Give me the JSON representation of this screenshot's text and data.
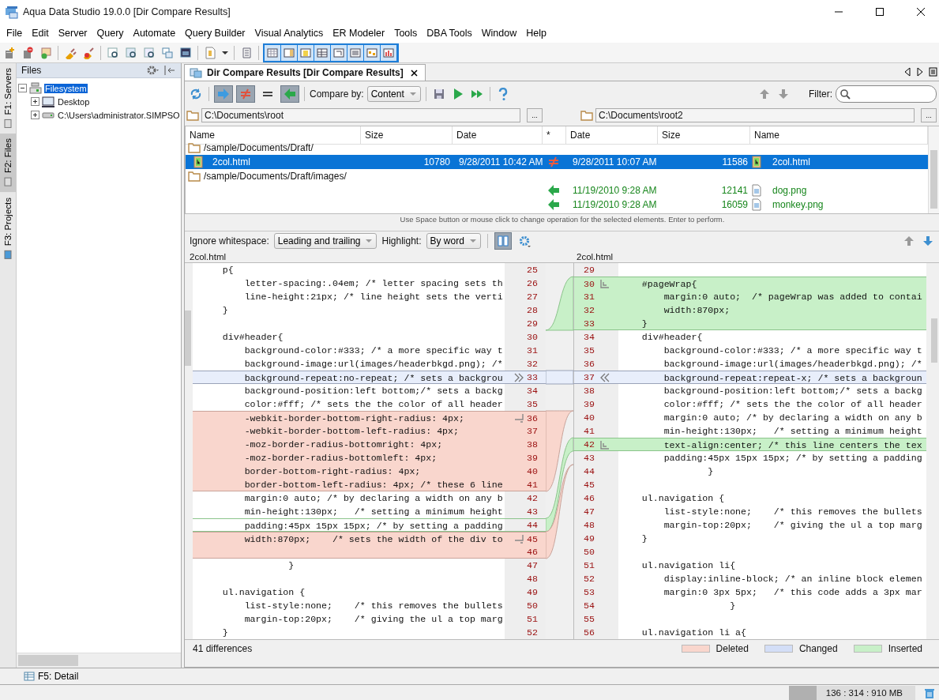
{
  "window": {
    "title": "Aqua Data Studio 19.0.0  [Dir Compare Results]"
  },
  "menu": [
    "File",
    "Edit",
    "Server",
    "Query",
    "Automate",
    "Query Builder",
    "Visual Analytics",
    "ER Modeler",
    "Tools",
    "DBA Tools",
    "Window",
    "Help"
  ],
  "side_tabs": [
    {
      "label": "F1: Servers",
      "selected": false
    },
    {
      "label": "F2: Files",
      "selected": true
    },
    {
      "label": "F3: Projects",
      "selected": false
    }
  ],
  "files_panel": {
    "title": "Files",
    "tree": [
      {
        "label": "Filesystem",
        "kind": "filesystem",
        "expanded": true,
        "selected": true,
        "children": [
          {
            "label": "Desktop",
            "kind": "desktop",
            "expanded": false,
            "selected": false
          },
          {
            "label": "C:\\Users\\administrator.SIMPSO",
            "kind": "drive",
            "expanded": false,
            "selected": false
          }
        ]
      }
    ]
  },
  "document_tab": {
    "title": "Dir Compare Results [Dir Compare Results]"
  },
  "compare_toolbar": {
    "toggles": [
      {
        "kind": "copy_right",
        "selected": true
      },
      {
        "kind": "different",
        "selected": true
      },
      {
        "kind": "equal",
        "selected": false
      },
      {
        "kind": "copy_left",
        "selected": true
      }
    ],
    "compare_by_label": "Compare by:",
    "compare_by": "Content",
    "filter_label": "Filter:"
  },
  "paths": [
    {
      "path": "C:\\Documents\\root",
      "browse": "..."
    },
    {
      "path": "C:\\Documents\\root2",
      "browse": "..."
    }
  ],
  "file_table": {
    "columns": [
      "Name",
      "Size",
      "Date",
      "*",
      "Date",
      "Size",
      "Name"
    ],
    "rows": [
      {
        "kind": "folder",
        "path": "/sample/Documents/Draft/",
        "selected": false
      },
      {
        "kind": "different",
        "selected": true,
        "left": {
          "kind": "html",
          "name": "2col.html",
          "size": "10780",
          "date": "9/28/2011 10:42 AM"
        },
        "right": {
          "kind": "html",
          "name": "2col.html",
          "size": "11586",
          "date": "9/28/2011 10:07 AM"
        }
      },
      {
        "kind": "folder",
        "path": "/sample/Documents/Draft/images/",
        "selected": false
      },
      {
        "kind": "right_only",
        "selected": false,
        "right": {
          "kind": "image",
          "name": "dog.png",
          "size": "12141",
          "date": "11/19/2010 9:28 AM"
        }
      },
      {
        "kind": "right_only",
        "selected": false,
        "right": {
          "kind": "image",
          "name": "monkey.png",
          "size": "16059",
          "date": "11/19/2010 9:28 AM"
        }
      }
    ],
    "hint": "Use Space button or mouse click to change operation for the selected elements. Enter to perform."
  },
  "diff_toolbar": {
    "ignore_label": "Ignore whitespace:",
    "ignore_value": "Leading and trailing",
    "highlight_label": "Highlight:",
    "highlight_value": "By word",
    "side_by_side": {
      "selected": true
    }
  },
  "diff": {
    "left": {
      "file": "2col.html",
      "lines": [
        {
          "num": "25",
          "text": "    p{",
          "kind": "normal"
        },
        {
          "num": "26",
          "text": "        letter-spacing:.04em; /* letter spacing sets th",
          "kind": "normal"
        },
        {
          "num": "27",
          "text": "        line-height:21px; /* line height sets the verti",
          "kind": "normal"
        },
        {
          "num": "28",
          "text": "    }",
          "kind": "normal"
        },
        {
          "num": "29",
          "kind": "normal"
        },
        {
          "num": "30",
          "text": "    div#header{",
          "kind": "normal"
        },
        {
          "num": "31",
          "text": "        background-color:#333; /* a more specific way t",
          "kind": "normal"
        },
        {
          "num": "32",
          "text": "        background-image:url(images/headerbkgd.png); /*",
          "kind": "normal"
        },
        {
          "num": "33",
          "text": "        background-repeat:no-repeat; /* sets a backgrou",
          "kind": "changed",
          "marker": true
        },
        {
          "num": "34",
          "text": "        background-position:left bottom;/* sets a backg",
          "kind": "normal"
        },
        {
          "num": "35",
          "text": "        color:#fff; /* sets the the color of all header",
          "kind": "normal"
        },
        {
          "num": "36",
          "text": "        -webkit-border-bottom-right-radius: 4px;",
          "kind": "deleted",
          "marker": true
        },
        {
          "num": "37",
          "text": "        -webkit-border-bottom-left-radius: 4px;",
          "kind": "deleted"
        },
        {
          "num": "38",
          "text": "        -moz-border-radius-bottomright: 4px;",
          "kind": "deleted"
        },
        {
          "num": "39",
          "text": "        -moz-border-radius-bottomleft: 4px;",
          "kind": "deleted"
        },
        {
          "num": "40",
          "text": "        border-bottom-right-radius: 4px;",
          "kind": "deleted"
        },
        {
          "num": "41",
          "text": "        border-bottom-left-radius: 4px; /* these 6 line",
          "kind": "deleted"
        },
        {
          "num": "42",
          "text": "        margin:0 auto; /* by declaring a width on any b",
          "kind": "normal"
        },
        {
          "num": "43",
          "text": "        min-height:130px;   /* setting a minimum height",
          "kind": "normal"
        },
        {
          "num": "44",
          "text": "        padding:45px 15px 15px; /* by setting a padding",
          "kind": "anchor"
        },
        {
          "num": "45",
          "text": "        width:870px;    /* sets the width of the div to",
          "kind": "deleted",
          "marker": true
        },
        {
          "num": "46",
          "kind": "deleted"
        },
        {
          "num": "47",
          "text": "                }",
          "kind": "normal"
        },
        {
          "num": "48",
          "kind": "normal"
        },
        {
          "num": "49",
          "text": "    ul.navigation {",
          "kind": "normal"
        },
        {
          "num": "50",
          "text": "        list-style:none;    /* this removes the bullets",
          "kind": "normal"
        },
        {
          "num": "51",
          "text": "        margin-top:20px;    /* giving the ul a top marg",
          "kind": "normal"
        },
        {
          "num": "52",
          "text": "    }",
          "kind": "normal"
        }
      ]
    },
    "right": {
      "file": "2col.html",
      "lines": [
        {
          "num": "29",
          "kind": "normal"
        },
        {
          "num": "30",
          "text": "    #pageWrap{",
          "kind": "inserted",
          "marker": true
        },
        {
          "num": "31",
          "text": "        margin:0 auto;  /* pageWrap was added to contai",
          "kind": "inserted"
        },
        {
          "num": "32",
          "text": "        width:870px;",
          "kind": "inserted"
        },
        {
          "num": "33",
          "text": "    }",
          "kind": "inserted"
        },
        {
          "num": "34",
          "text": "    div#header{",
          "kind": "normal"
        },
        {
          "num": "35",
          "text": "        background-color:#333; /* a more specific way t",
          "kind": "normal"
        },
        {
          "num": "36",
          "text": "        background-image:url(images/headerbkgd.png); /*",
          "kind": "normal"
        },
        {
          "num": "37",
          "text": "        background-repeat:repeat-x; /* sets a backgroun",
          "kind": "changed",
          "marker": true
        },
        {
          "num": "38",
          "text": "        background-position:left bottom;/* sets a backg",
          "kind": "normal"
        },
        {
          "num": "39",
          "text": "        color:#fff; /* sets the the color of all header",
          "kind": "normal"
        },
        {
          "num": "40",
          "text": "        margin:0 auto; /* by declaring a width on any b",
          "kind": "normal"
        },
        {
          "num": "41",
          "text": "        min-height:130px;   /* setting a minimum height",
          "kind": "normal"
        },
        {
          "num": "42",
          "text": "        text-align:center; /* this line centers the tex",
          "kind": "inserted",
          "marker": true
        },
        {
          "num": "43",
          "text": "        padding:45px 15px 15px; /* by setting a padding",
          "kind": "normal"
        },
        {
          "num": "44",
          "text": "                }",
          "kind": "normal"
        },
        {
          "num": "45",
          "kind": "normal"
        },
        {
          "num": "46",
          "text": "    ul.navigation {",
          "kind": "normal"
        },
        {
          "num": "47",
          "text": "        list-style:none;    /* this removes the bullets",
          "kind": "normal"
        },
        {
          "num": "48",
          "text": "        margin-top:20px;    /* giving the ul a top marg",
          "kind": "normal"
        },
        {
          "num": "49",
          "text": "    }",
          "kind": "normal"
        },
        {
          "num": "50",
          "kind": "normal"
        },
        {
          "num": "51",
          "text": "    ul.navigation li{",
          "kind": "normal"
        },
        {
          "num": "52",
          "text": "        display:inline-block; /* an inline block elemen",
          "kind": "normal"
        },
        {
          "num": "53",
          "text": "        margin:0 3px 5px;   /* this code adds a 3px mar",
          "kind": "normal"
        },
        {
          "num": "54",
          "text": "                    }",
          "kind": "normal"
        },
        {
          "num": "55",
          "kind": "normal"
        },
        {
          "num": "56",
          "text": "    ul.navigation li a{",
          "kind": "normal"
        }
      ]
    }
  },
  "summary": "41 differences",
  "legend": [
    {
      "label": "Deleted",
      "color": "#f9d6cd"
    },
    {
      "label": "Changed",
      "color": "#d3def7"
    },
    {
      "label": "Inserted",
      "color": "#c8f0c8"
    }
  ],
  "detail_tab": {
    "label": "F5: Detail"
  },
  "status_bar": {
    "memory": {
      "reading": "136 : 314 : 910 MB",
      "level": 0.22
    }
  }
}
